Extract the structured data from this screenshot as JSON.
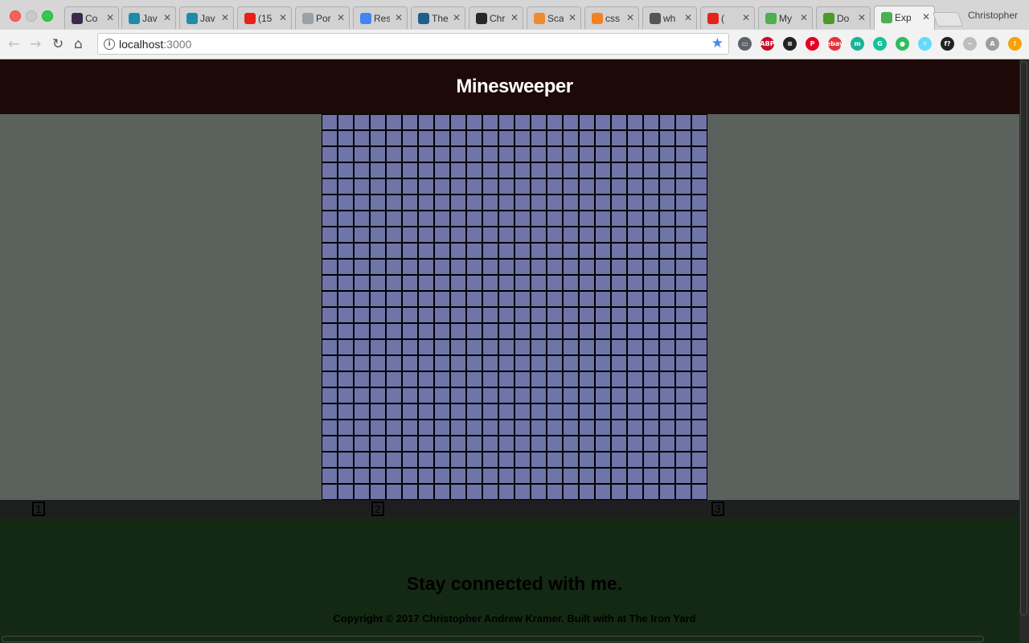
{
  "browser": {
    "profile_name": "Christopher",
    "tabs": [
      {
        "label": "Co",
        "icon": "codepen-icon",
        "color": "#3b2b4a"
      },
      {
        "label": "Jav",
        "icon": "code-icon",
        "color": "#1e8ba8"
      },
      {
        "label": "Jav",
        "icon": "code-icon",
        "color": "#1e8ba8"
      },
      {
        "label": "(15",
        "icon": "youtube-icon",
        "color": "#e62117"
      },
      {
        "label": "Por",
        "icon": "document-icon",
        "color": "#9aa0a6"
      },
      {
        "label": "Res",
        "icon": "google-docs-icon",
        "color": "#4285f4"
      },
      {
        "label": "The",
        "icon": "circle-x-icon",
        "color": "#1f5f8b"
      },
      {
        "label": "Chr",
        "icon": "github-icon",
        "color": "#24292e"
      },
      {
        "label": "Sca",
        "icon": "asterisk-icon",
        "color": "#ef8a2d"
      },
      {
        "label": "css",
        "icon": "stackoverflow-icon",
        "color": "#f48024"
      },
      {
        "label": "wh",
        "icon": "apple-icon",
        "color": "#555555"
      },
      {
        "label": "(",
        "icon": "youtube-icon",
        "color": "#e62117"
      },
      {
        "label": "My",
        "icon": "green-square-icon",
        "color": "#4caf50"
      },
      {
        "label": "Do",
        "icon": "evernote-icon",
        "color": "#4c9a2a"
      },
      {
        "label": "Exp",
        "icon": "green-square-icon",
        "color": "#4caf50",
        "active": true
      }
    ],
    "url_host": "localhost",
    "url_port": ":3000",
    "extensions": [
      {
        "name": "cast-icon",
        "text": "▭",
        "color": "#5f6368"
      },
      {
        "name": "adblock-plus-icon",
        "text": "ABP",
        "color": "#c70d2c"
      },
      {
        "name": "buffer-icon",
        "text": "≡",
        "color": "#222222"
      },
      {
        "name": "pinterest-icon",
        "text": "P",
        "color": "#e60023"
      },
      {
        "name": "ebay-icon",
        "text": "ebay",
        "color": "#e53238"
      },
      {
        "name": "momentum-icon",
        "text": "m",
        "color": "#1ab394"
      },
      {
        "name": "grammarly-icon",
        "text": "G",
        "color": "#15c39a"
      },
      {
        "name": "evernote-web-clipper-icon",
        "text": "●",
        "color": "#2dbe60"
      },
      {
        "name": "react-devtools-icon",
        "text": "⚛",
        "color": "#61dafb"
      },
      {
        "name": "font-finder-icon",
        "text": "f?",
        "color": "#222222"
      },
      {
        "name": "feather-icon",
        "text": "~",
        "color": "#bdbdbd"
      },
      {
        "name": "translate-icon",
        "text": "A",
        "color": "#9e9e9e"
      },
      {
        "name": "update-alert-icon",
        "text": "!",
        "color": "#f4a30a"
      }
    ]
  },
  "page": {
    "title": "Minesweeper",
    "board": {
      "rows": 24,
      "cols": 24,
      "cell_color": "#6f75a8",
      "border_color": "#000000"
    },
    "levels": [
      "1",
      "2",
      "3"
    ],
    "footer": {
      "heading": "Stay connected with me.",
      "copyright": "Copyright © 2017 Christopher Andrew Kramer. Built with at The Iron Yard"
    }
  }
}
